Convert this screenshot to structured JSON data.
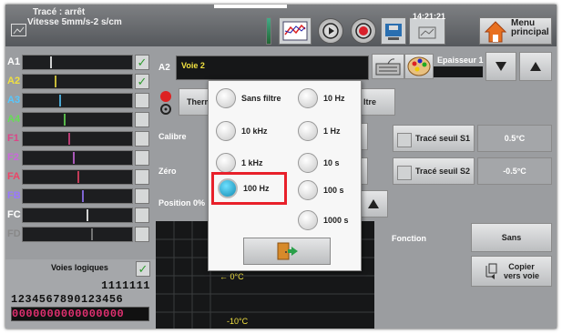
{
  "topbar": {
    "status_line1": "Tracé : arrêt",
    "status_line2": "Vitesse 5mm/s-2 s/cm",
    "time": "14:21:21",
    "menu_line1": "Menu",
    "menu_line2": "principal"
  },
  "channels": [
    {
      "label": "A1",
      "color": "#ffffff",
      "checked": true
    },
    {
      "label": "A2",
      "color": "#f0e040",
      "checked": true
    },
    {
      "label": "A3",
      "color": "#55c8ff",
      "checked": false
    },
    {
      "label": "A4",
      "color": "#66dd55",
      "checked": false
    },
    {
      "label": "F1",
      "color": "#dd4488",
      "checked": false
    },
    {
      "label": "F2",
      "color": "#cc66dd",
      "checked": false
    },
    {
      "label": "FA",
      "color": "#ee4466",
      "checked": false
    },
    {
      "label": "FB",
      "color": "#9977ff",
      "checked": false
    },
    {
      "label": "FC",
      "color": "#ffffff",
      "checked": false
    },
    {
      "label": "FD",
      "color": "#888888",
      "checked": false
    }
  ],
  "logic": {
    "label": "Voies logiques",
    "digits_top": "1111111",
    "digits_bottom": "1234567890123456",
    "values": "0000000000000000"
  },
  "channel_panel": {
    "name": "A2",
    "voie": "Voie 2",
    "thermo_button": "Therm",
    "filter_button_fragment": "ltre",
    "epaisseur": "Epaisseur 1",
    "calibre": "Calibre",
    "zero": "Zéro",
    "position": "Position 0%",
    "seuil1": "Tracé seuil S1",
    "seuil1_value": "0.5°C",
    "seuil2": "Tracé seuil S2",
    "seuil2_value": "-0.5°C",
    "fonction": "Fonction",
    "fonction_value": "Sans",
    "copier_line1": "Copier",
    "copier_line2": "vers voie",
    "graph_label_zero": "0°C",
    "graph_label_minus": "-10°C"
  },
  "filter_popup": {
    "options": [
      {
        "label": "Sans filtre",
        "selected": false
      },
      {
        "label": "10 Hz",
        "selected": false
      },
      {
        "label": "10 kHz",
        "selected": false
      },
      {
        "label": "1 Hz",
        "selected": false
      },
      {
        "label": "1 kHz",
        "selected": false
      },
      {
        "label": "10 s",
        "selected": false
      },
      {
        "label": "100 Hz",
        "selected": true
      },
      {
        "label": "100 s",
        "selected": false
      },
      {
        "label": "1000 s",
        "selected": false
      }
    ],
    "highlight_color": "#e8202a"
  },
  "icons": {
    "trace": "trace-icon",
    "chart": "chart-icon",
    "play": "play-icon",
    "record": "record-icon",
    "save": "save-icon",
    "clock": "clock-icon",
    "home": "home-icon",
    "keyboard": "keyboard-icon",
    "palette": "palette-icon",
    "down": "triangle-down-icon",
    "up": "triangle-up-icon",
    "exit": "exit-door-icon",
    "copy": "copy-icon"
  }
}
